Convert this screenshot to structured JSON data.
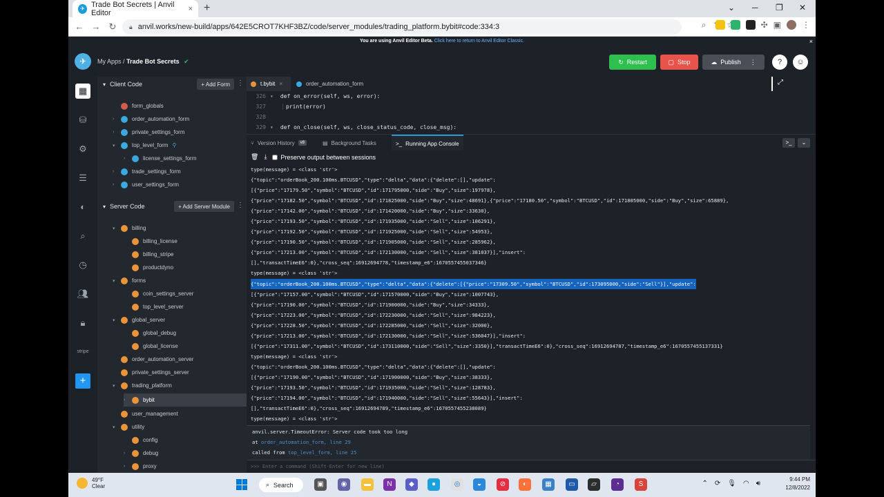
{
  "browser": {
    "tab_title": "Trade Bot Secrets | Anvil Editor",
    "tab_close": "×",
    "new_tab": "+",
    "url": "anvil.works/new-build/apps/642E5CROT7KHF3BZ/code/server_modules/trading_platform.bybit#code:334:3",
    "win_min": "⌄",
    "win_restore": "─",
    "win_max": "❐",
    "win_close": "✕"
  },
  "banner": {
    "text": "You are using Anvil Editor Beta.",
    "link": "Click here to return to Anvil Editor Classic.",
    "close": "×"
  },
  "header": {
    "my_apps": "My Apps",
    "separator": "/",
    "app_name": "Trade Bot Secrets",
    "restart_label": "Restart",
    "stop_label": "Stop",
    "publish_label": "Publish",
    "help": "?",
    "more": "⋮"
  },
  "sidebar": {
    "client_code_title": "Client Code",
    "add_form_label": "+ Add Form",
    "client_items": [
      {
        "label": "form_globals",
        "type": "red"
      },
      {
        "label": "order_automation_form",
        "type": "blue"
      },
      {
        "label": "private_settings_form",
        "type": "blue"
      },
      {
        "label": "top_level_form",
        "type": "blue"
      },
      {
        "label": "license_settings_form",
        "type": "blue"
      },
      {
        "label": "trade_settings_form",
        "type": "blue"
      },
      {
        "label": "user_settings_form",
        "type": "blue"
      }
    ],
    "server_code_title": "Server Code",
    "add_server_module_label": "+ Add Server Module",
    "server_items": [
      {
        "label": "billing"
      },
      {
        "label": "billing_license"
      },
      {
        "label": "billing_stripe"
      },
      {
        "label": "productdyno"
      },
      {
        "label": "forms"
      },
      {
        "label": "coin_settings_server"
      },
      {
        "label": "top_level_server"
      },
      {
        "label": "global_server"
      },
      {
        "label": "global_debug"
      },
      {
        "label": "global_license"
      },
      {
        "label": "order_automation_server"
      },
      {
        "label": "private_settings_server"
      },
      {
        "label": "trading_platform"
      },
      {
        "label": "bybit"
      },
      {
        "label": "user_management"
      },
      {
        "label": "utility"
      },
      {
        "label": "config"
      },
      {
        "label": "debug"
      },
      {
        "label": "proxy"
      }
    ]
  },
  "rail": {
    "stripe": "stripe",
    "plus": "+"
  },
  "editor": {
    "tabs": [
      {
        "label": "t.bybit",
        "close": "×"
      },
      {
        "label": "order_automation_form"
      }
    ],
    "lines": [
      {
        "num": "326",
        "text": "def on_error(self, ws, error):"
      },
      {
        "num": "327",
        "text": "print(error)"
      },
      {
        "num": "328",
        "text": ""
      },
      {
        "num": "329",
        "text": "def on_close(self, ws, close_status_code, close_msg):"
      }
    ]
  },
  "panel": {
    "tabs": [
      {
        "label": "Version History",
        "badge": "v8"
      },
      {
        "label": "Background Tasks"
      },
      {
        "label": "Running App Console"
      }
    ],
    "preserve_label": "Preserve output between sessions"
  },
  "console": {
    "lines": [
      "type(message) = <class 'str'>",
      "{\"topic\":\"orderBook_200.100ms.BTCUSD\",\"type\":\"delta\",\"data\":{\"delete\":[],\"update\":",
      "[{\"price\":\"17179.50\",\"symbol\":\"BTCUSD\",\"id\":171795000,\"side\":\"Buy\",\"size\":197978},",
      "{\"price\":\"17182.50\",\"symbol\":\"BTCUSD\",\"id\":171825000,\"side\":\"Buy\",\"size\":48691},{\"price\":\"17180.50\",\"symbol\":\"BTCUSD\",\"id\":171805000,\"side\":\"Buy\",\"size\":65889},",
      "{\"price\":\"17142.00\",\"symbol\":\"BTCUSD\",\"id\":171420000,\"side\":\"Buy\",\"size\":33630},",
      "{\"price\":\"17193.50\",\"symbol\":\"BTCUSD\",\"id\":171935000,\"side\":\"Sell\",\"size\":106291},",
      "{\"price\":\"17192.50\",\"symbol\":\"BTCUSD\",\"id\":171925000,\"side\":\"Sell\",\"size\":54953},",
      "{\"price\":\"17190.50\",\"symbol\":\"BTCUSD\",\"id\":171905000,\"side\":\"Sell\",\"size\":285962},",
      "{\"price\":\"17213.00\",\"symbol\":\"BTCUSD\",\"id\":172130000,\"side\":\"Sell\",\"size\":381037}],\"insert\":",
      "[],\"transactTimeE6\":0},\"cross_seq\":16912694778,\"timestamp_e6\":1670557455037346}",
      "type(message) = <class 'str'>",
      "{\"topic\":\"orderBook_200.100ms.BTCUSD\",\"type\":\"delta\",\"data\":{\"delete\":[{\"price\":\"17309.50\",\"symbol\":\"BTCUSD\",\"id\":173095000,\"side\":\"Sell\"}],\"update\":",
      "[{\"price\":\"17157.00\",\"symbol\":\"BTCUSD\",\"id\":171570000,\"side\":\"Buy\",\"size\":1007743},",
      "{\"price\":\"17190.00\",\"symbol\":\"BTCUSD\",\"id\":171900000,\"side\":\"Buy\",\"size\":34333},",
      "{\"price\":\"17223.00\",\"symbol\":\"BTCUSD\",\"id\":172230000,\"side\":\"Sell\",\"size\":984223},",
      "{\"price\":\"17228.50\",\"symbol\":\"BTCUSD\",\"id\":172285000,\"side\":\"Sell\",\"size\":32000},",
      "{\"price\":\"17213.00\",\"symbol\":\"BTCUSD\",\"id\":172130000,\"side\":\"Sell\",\"size\":536047}],\"insert\":",
      "[{\"price\":\"17311.00\",\"symbol\":\"BTCUSD\",\"id\":173110000,\"side\":\"Sell\",\"size\":3350}],\"transactTimeE6\":0},\"cross_seq\":16912694787,\"timestamp_e6\":1670557455137331}",
      "type(message) = <class 'str'>",
      "{\"topic\":\"orderBook_200.100ms.BTCUSD\",\"type\":\"delta\",\"data\":{\"delete\":[],\"update\":",
      "[{\"price\":\"17190.00\",\"symbol\":\"BTCUSD\",\"id\":171900000,\"side\":\"Buy\",\"size\":38333},",
      "{\"price\":\"17193.50\",\"symbol\":\"BTCUSD\",\"id\":171935000,\"side\":\"Sell\",\"size\":128783},",
      "{\"price\":\"17194.00\",\"symbol\":\"BTCUSD\",\"id\":171940000,\"side\":\"Sell\",\"size\":55643}],\"insert\":",
      "[],\"transactTimeE6\":0},\"cross_seq\":16912694789,\"timestamp_e6\":1670557455238089}",
      "type(message) = <class 'str'>"
    ],
    "error": {
      "line1": "anvil.server.TimeoutError: Server code took too long",
      "at_prefix": "at ",
      "at_link": "order_automation_form, line 29",
      "called_prefix": "called from ",
      "called_link": "top_level_form, line 25"
    },
    "command_placeholder": ">>> Enter a command (Shift-Enter for new line)"
  },
  "taskbar": {
    "temp": "49°F",
    "weather": "Clear",
    "search_label": "Search",
    "time": "9:44 PM",
    "date": "12/8/2022"
  }
}
